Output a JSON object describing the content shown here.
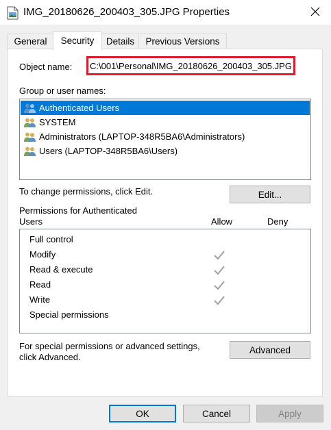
{
  "window": {
    "title": "IMG_20180626_200403_305.JPG Properties"
  },
  "tabs": [
    {
      "label": "General"
    },
    {
      "label": "Security"
    },
    {
      "label": "Details"
    },
    {
      "label": "Previous Versions"
    }
  ],
  "security": {
    "object_name_label": "Object name:",
    "object_name_value": "C:\\001\\Personal\\IMG_20180626_200403_305.JPG",
    "group_label": "Group or user names:",
    "users": [
      {
        "name": "Authenticated Users",
        "selected": true
      },
      {
        "name": "SYSTEM",
        "selected": false
      },
      {
        "name": "Administrators (LAPTOP-348R5BA6\\Administrators)",
        "selected": false
      },
      {
        "name": "Users (LAPTOP-348R5BA6\\Users)",
        "selected": false
      }
    ],
    "change_hint": "To change permissions, click Edit.",
    "edit_button": "Edit...",
    "permissions_for_line1": "Permissions for Authenticated",
    "permissions_for_line2": "Users",
    "allow_header": "Allow",
    "deny_header": "Deny",
    "permissions": [
      {
        "name": "Full control",
        "allow": false,
        "deny": false
      },
      {
        "name": "Modify",
        "allow": true,
        "deny": false
      },
      {
        "name": "Read & execute",
        "allow": true,
        "deny": false
      },
      {
        "name": "Read",
        "allow": true,
        "deny": false
      },
      {
        "name": "Write",
        "allow": true,
        "deny": false
      },
      {
        "name": "Special permissions",
        "allow": false,
        "deny": false
      }
    ],
    "advanced_hint_line1": "For special permissions or advanced settings,",
    "advanced_hint_line2": "click Advanced.",
    "advanced_button": "Advanced"
  },
  "footer": {
    "ok_button": "OK",
    "cancel_button": "Cancel",
    "apply_button": "Apply"
  },
  "colors": {
    "selection": "#0078d7",
    "highlight_border": "#e01c2c",
    "check_gray": "#a0a0a0"
  }
}
